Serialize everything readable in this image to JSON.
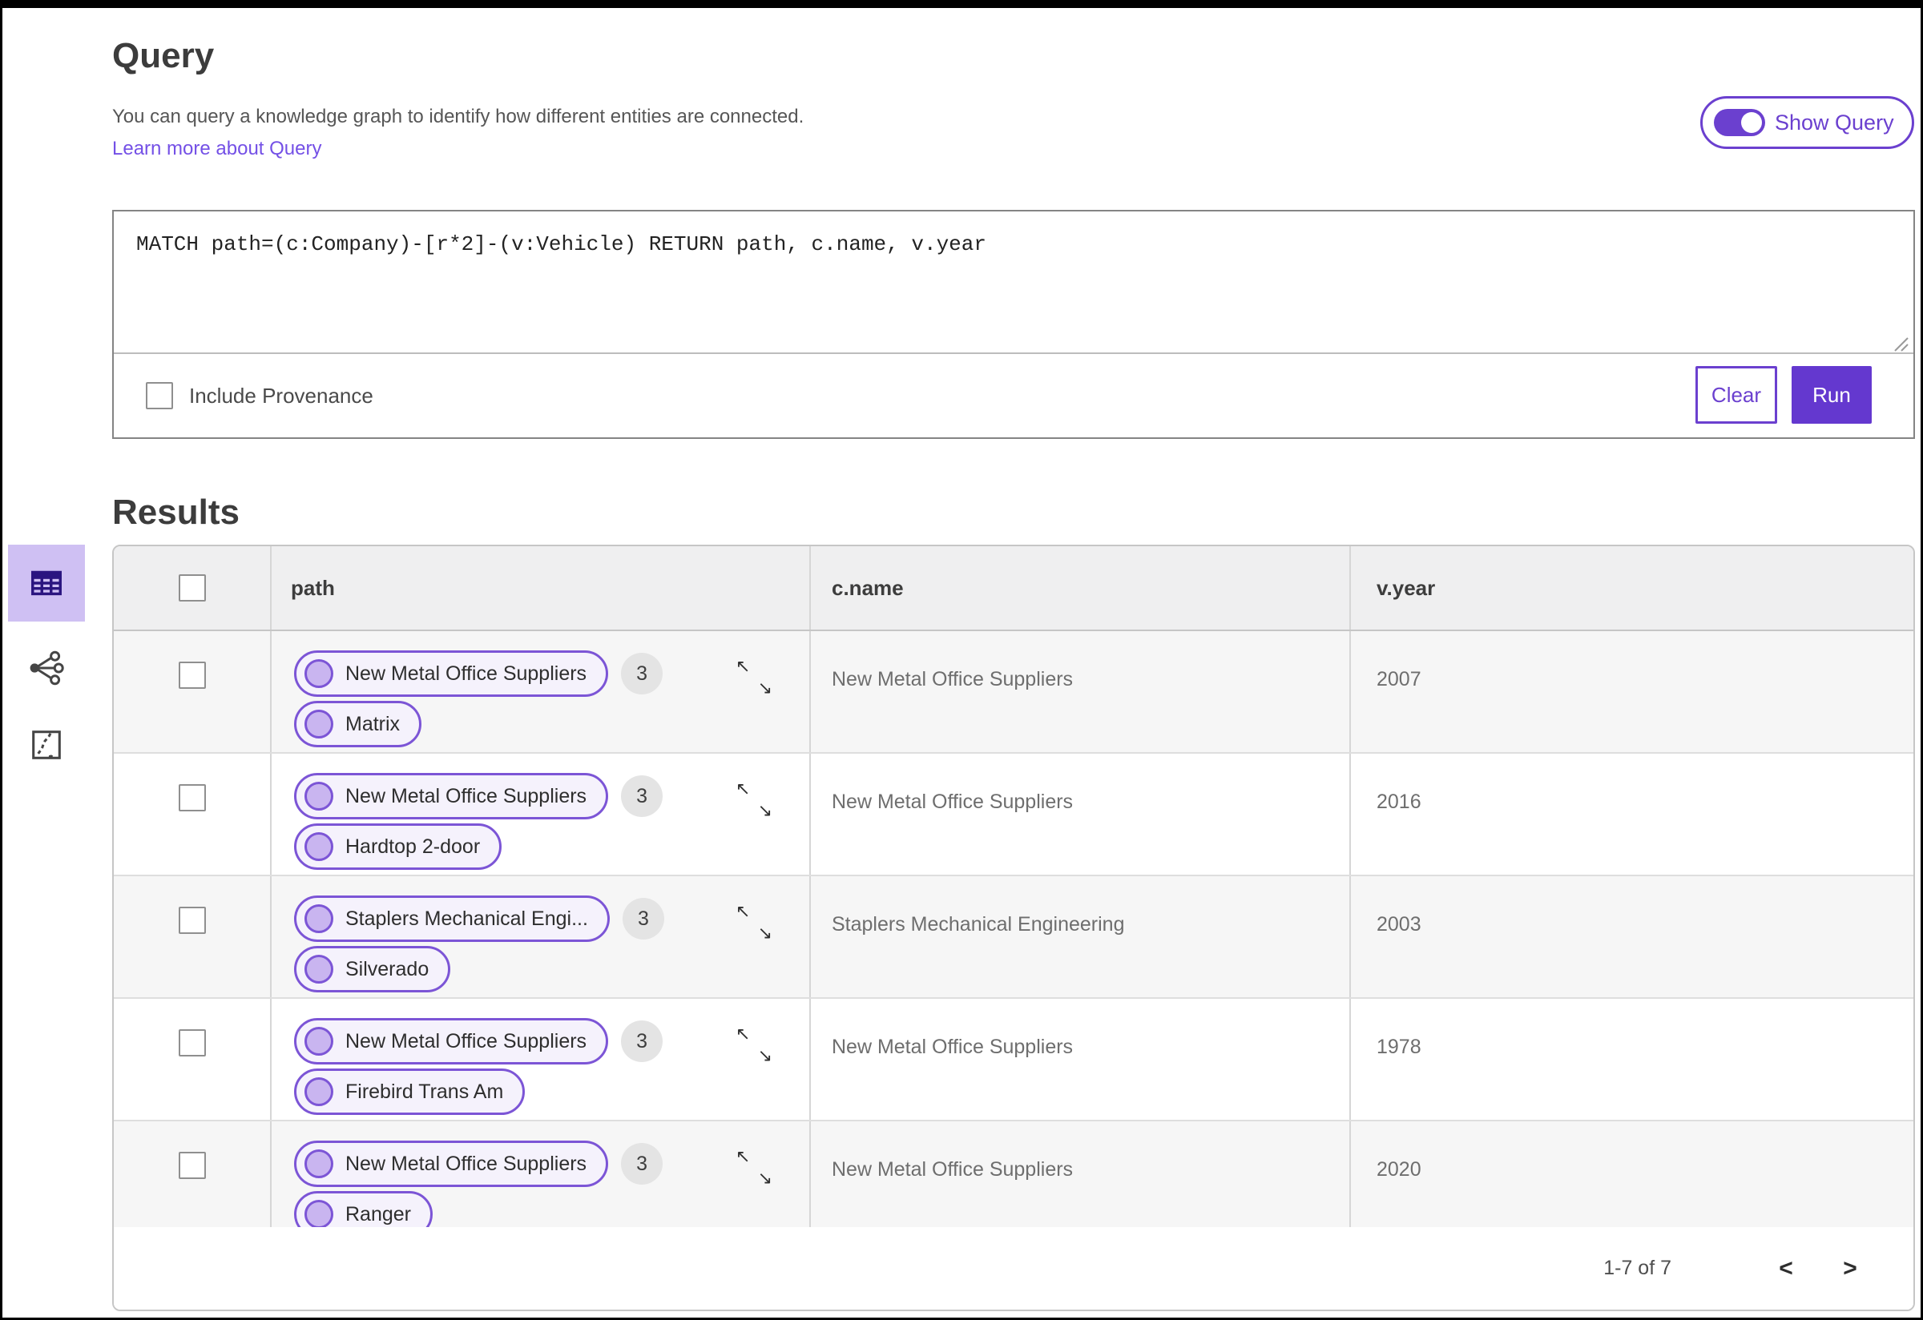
{
  "query_section": {
    "title": "Query",
    "description": "You can query a knowledge graph to identify how different entities are connected.",
    "learn_more_label": "Learn more about Query",
    "show_query_label": "Show Query",
    "show_query_on": true
  },
  "query_editor": {
    "text": "MATCH path=(c:Company)-[r*2]-(v:Vehicle) RETURN path, c.name, v.year",
    "include_provenance_label": "Include Provenance",
    "include_provenance_checked": false,
    "clear_label": "Clear",
    "run_label": "Run"
  },
  "results": {
    "heading": "Results",
    "view_buttons": [
      {
        "icon": "table-view-icon",
        "active": true
      },
      {
        "icon": "graph-view-icon",
        "active": false
      },
      {
        "icon": "map-view-icon",
        "active": false
      }
    ],
    "columns": [
      "path",
      "c.name",
      "v.year"
    ],
    "rows": [
      {
        "path_nodes": [
          "New Metal Office Suppliers",
          "Matrix"
        ],
        "count": "3",
        "c_name": "New Metal Office Suppliers",
        "v_year": "2007"
      },
      {
        "path_nodes": [
          "New Metal Office Suppliers",
          "Hardtop 2-door"
        ],
        "count": "3",
        "c_name": "New Metal Office Suppliers",
        "v_year": "2016"
      },
      {
        "path_nodes": [
          "Staplers Mechanical Engi...",
          "Silverado"
        ],
        "count": "3",
        "c_name": "Staplers Mechanical Engineering",
        "v_year": "2003"
      },
      {
        "path_nodes": [
          "New Metal Office Suppliers",
          "Firebird Trans Am"
        ],
        "count": "3",
        "c_name": "New Metal Office Suppliers",
        "v_year": "1978"
      },
      {
        "path_nodes": [
          "New Metal Office Suppliers",
          "Ranger"
        ],
        "count": "3",
        "c_name": "New Metal Office Suppliers",
        "v_year": "2020"
      }
    ],
    "pagination": {
      "label": "1-7 of 7"
    }
  },
  "icons": {
    "expand_nw": "↖",
    "expand_se": "↘",
    "prev": "<",
    "next": ">"
  },
  "colors": {
    "accent": "#6b40cf",
    "run_button": "#6438cf",
    "link": "#7450e6",
    "pill_border": "#7c55d6",
    "pill_bg": "#f5f2fc",
    "node_fill": "#c9b5f0",
    "active_view_bg": "#cfc0f3",
    "header_bg": "#efeff0",
    "row_alt_bg": "#f6f6f6"
  }
}
